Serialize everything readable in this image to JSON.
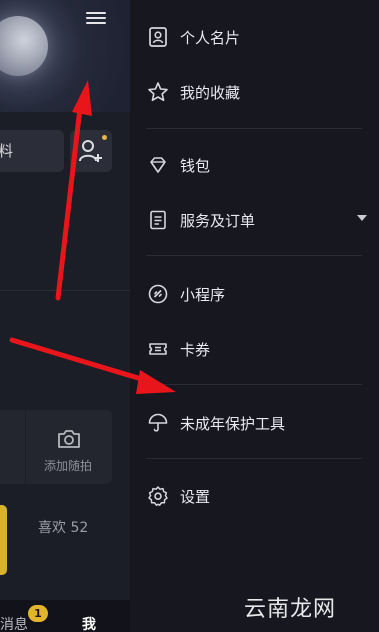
{
  "profile": {
    "data_chip_text": "料",
    "add_snap_label": "添加随拍",
    "likes_label": "喜欢 52"
  },
  "bottom_nav": {
    "messages_label": "消息",
    "messages_badge": "1",
    "me_label": "我"
  },
  "drawer": {
    "items": [
      {
        "label": "个人名片",
        "icon": "id-card-icon"
      },
      {
        "label": "我的收藏",
        "icon": "star-icon"
      },
      {
        "label": "钱包",
        "icon": "diamond-icon"
      },
      {
        "label": "服务及订单",
        "icon": "list-icon"
      },
      {
        "label": "小程序",
        "icon": "link-icon"
      },
      {
        "label": "卡券",
        "icon": "ticket-icon"
      },
      {
        "label": "未成年保护工具",
        "icon": "umbrella-icon"
      },
      {
        "label": "设置",
        "icon": "gear-icon"
      }
    ]
  },
  "watermark": "云南龙网",
  "colors": {
    "accent_yellow": "#e3b52c",
    "annotation_red": "#e8161b",
    "drawer_bg": "#16171f"
  }
}
